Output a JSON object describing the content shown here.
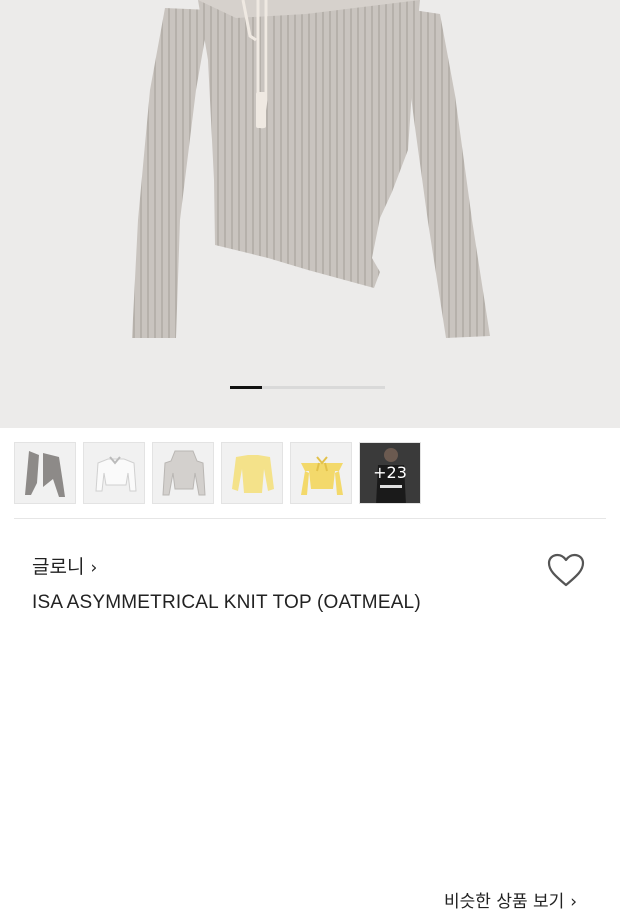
{
  "product_images": {
    "current_index": 1,
    "total": 5
  },
  "thumbnails": [
    {
      "color": "#8d8a88",
      "icon": "gray-top-thumbnail"
    },
    {
      "color": "#e6e6e6",
      "icon": "white-top-thumbnail"
    },
    {
      "color": "#c9c6c3",
      "icon": "hooded-top-thumbnail"
    },
    {
      "color": "#f4e28a",
      "icon": "yellow-top-thumbnail"
    },
    {
      "color": "#f3d96b",
      "icon": "yellow-offshoulder-thumbnail"
    },
    {
      "icon": "model-photo-thumbnail",
      "more_label": "+23"
    }
  ],
  "similar_link": {
    "label": "비슷한 상품 보기",
    "chevron": "›"
  },
  "brand": {
    "name": "글로니",
    "chevron": "›"
  },
  "product": {
    "title": "ISA ASYMMETRICAL KNIT TOP (OATMEAL)"
  },
  "colors": {
    "sweater": "#cbc6c1",
    "background": "#ecebea",
    "text": "#222222"
  }
}
